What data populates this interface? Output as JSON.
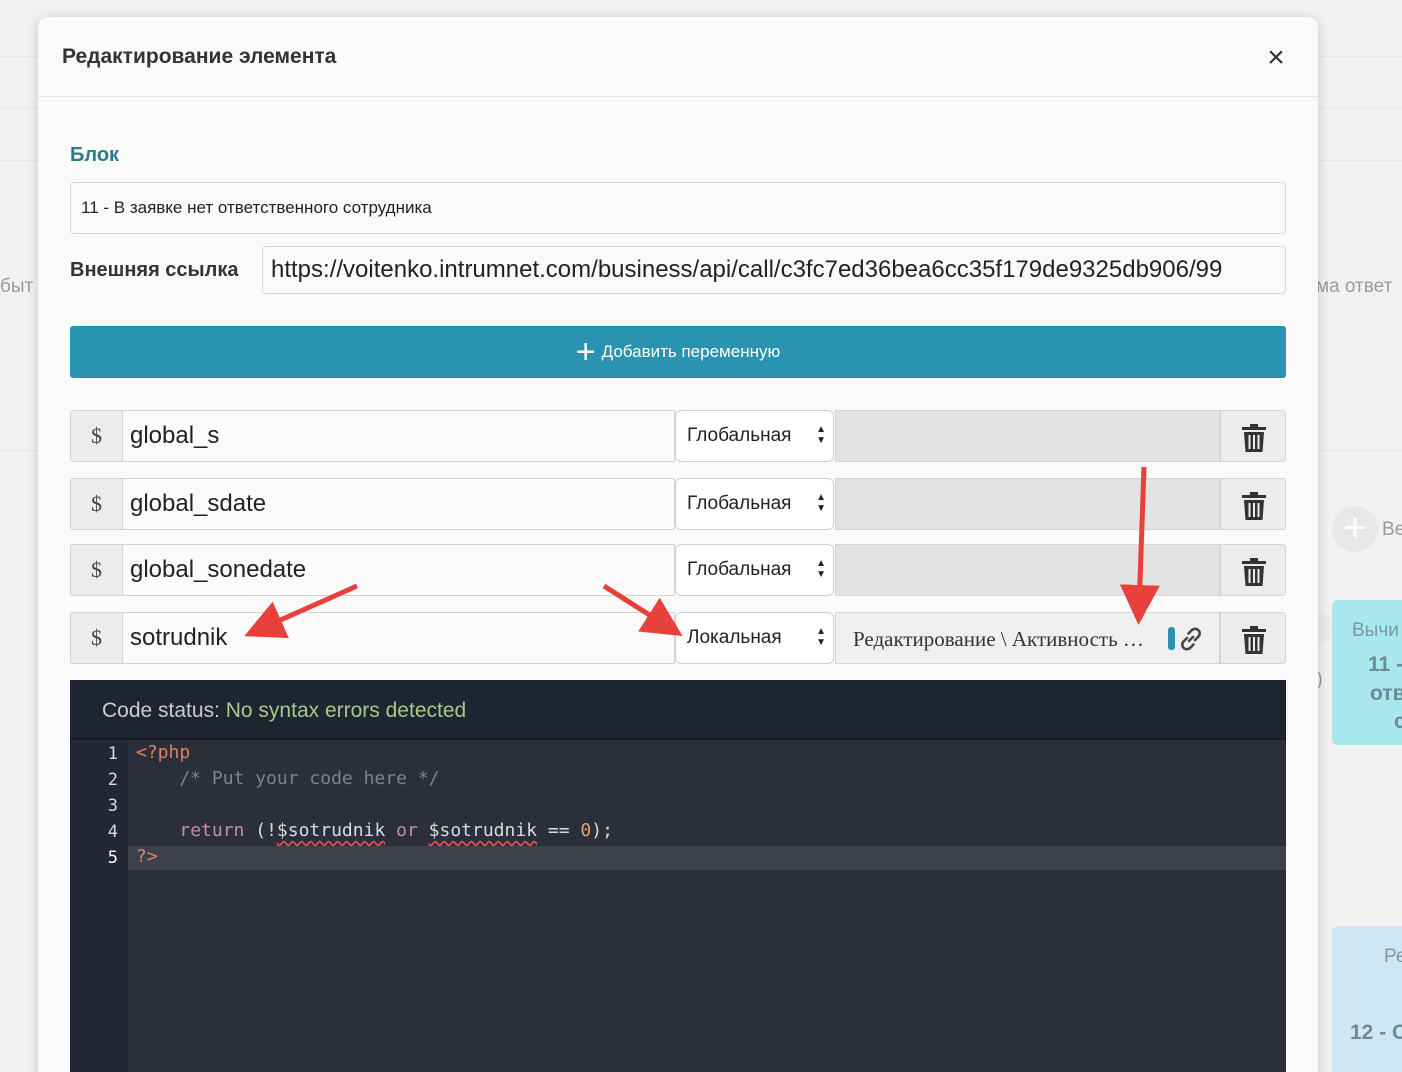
{
  "background": {
    "left_fragment": "быт",
    "right_fragment": "ма ответ",
    "right_button_fragment": "Be",
    "right_paren": "r)",
    "card1_title": "Вычи",
    "card1_line1": "11 -",
    "card1_line2": "отв",
    "card1_line3": "с",
    "card2_title": "Ре",
    "card2_line1": "12 - С"
  },
  "modal": {
    "title": "Редактирование элемента",
    "close_label": "×"
  },
  "form": {
    "block_label": "Блок",
    "block_value": "11 - В заявке нет ответственного сотрудника",
    "link_label": "Внешняя ссылка",
    "link_value": "https://voitenko.intrumnet.com/business/api/call/c3fc7ed36bea6cc35f179de9325db906/99",
    "add_variable_label": "Добавить переменную",
    "add_variable_icon": "plus-icon"
  },
  "variables": [
    {
      "prefix": "$",
      "name": "global_s",
      "scope": "Глобальная",
      "value": ""
    },
    {
      "prefix": "$",
      "name": "global_sdate",
      "scope": "Глобальная",
      "value": ""
    },
    {
      "prefix": "$",
      "name": "global_sonedate",
      "scope": "Глобальная",
      "value": ""
    },
    {
      "prefix": "$",
      "name": "sotrudnik",
      "scope": "Локальная",
      "value": "Редактирование \\ Активность …"
    }
  ],
  "editor": {
    "status_label": "Code status:",
    "status_value": "No syntax errors detected",
    "line_numbers": [
      "1",
      "2",
      "3",
      "4",
      "5"
    ],
    "code": {
      "l1": "<?php",
      "l2": "    /* Put your code here */",
      "l4_return": "return",
      "l4_open": " (!",
      "l4_var1": "$sotrudnik",
      "l4_or": "or",
      "l4_var2": "$sotrudnik",
      "l4_eq": " == ",
      "l4_num": "0",
      "l4_close": ");",
      "l5": "?>"
    }
  },
  "colors": {
    "accent": "#2a93b0",
    "block_label": "#2a7c8c",
    "editor_bg": "#2b2f3a",
    "status_ok": "#a6c98a",
    "arrow": "#e8403a"
  }
}
